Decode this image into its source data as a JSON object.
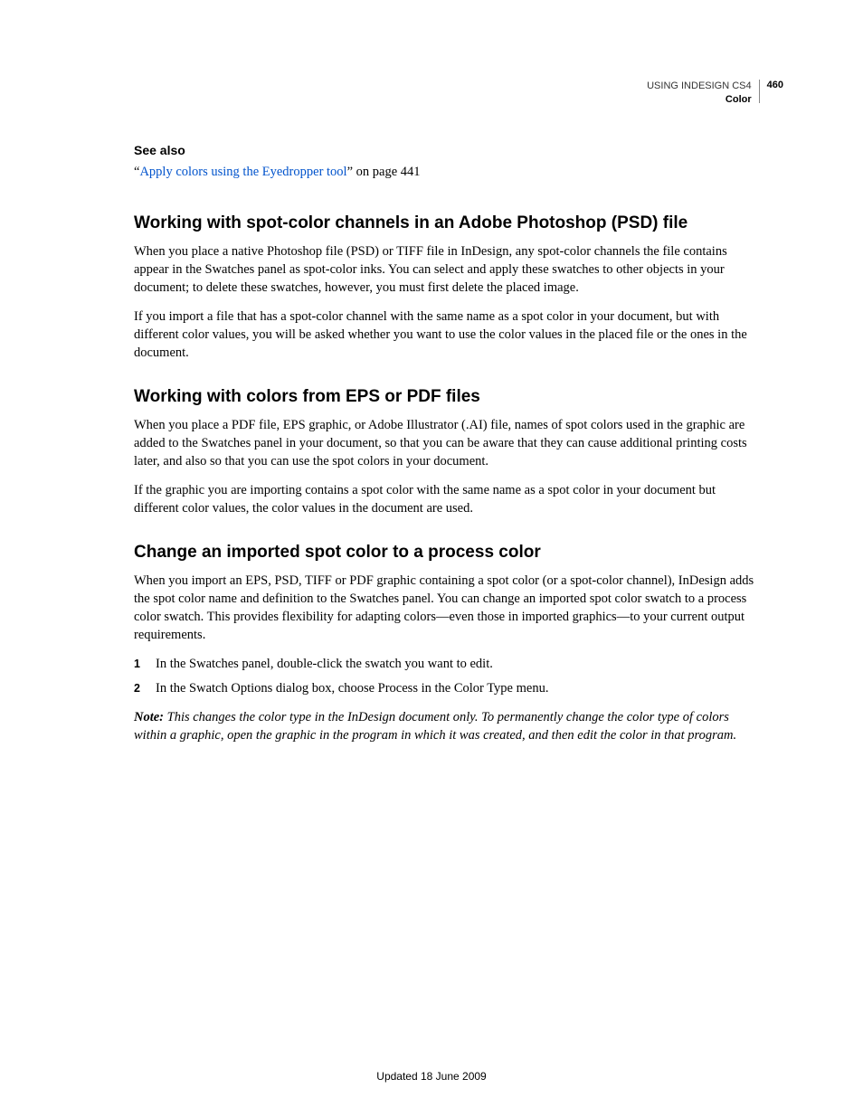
{
  "header": {
    "title": "USING INDESIGN CS4",
    "section": "Color",
    "page": "460"
  },
  "see_also": {
    "label": "See also",
    "quote_open": "“",
    "link": "Apply colors using the Eyedropper tool",
    "suffix": "” on page 441"
  },
  "sections": [
    {
      "heading": "Working with spot-color channels in an Adobe Photoshop (PSD) file",
      "paragraphs": [
        "When you place a native Photoshop file (PSD) or TIFF file in InDesign, any spot-color channels the file contains appear in the Swatches panel as spot-color inks. You can select and apply these swatches to other objects in your document; to delete these swatches, however, you must first delete the placed image.",
        "If you import a file that has a spot-color channel with the same name as a spot color in your document, but with different color values, you will be asked whether you want to use the color values in the placed file or the ones in the document."
      ]
    },
    {
      "heading": "Working with colors from EPS or PDF files",
      "paragraphs": [
        "When you place a PDF file, EPS graphic, or Adobe Illustrator (.AI) file, names of spot colors used in the graphic are added to the Swatches panel in your document, so that you can be aware that they can cause additional printing costs later, and also so that you can use the spot colors in your document.",
        "If the graphic you are importing contains a spot color with the same name as a spot color in your document but different color values, the color values in the document are used."
      ]
    },
    {
      "heading": "Change an imported spot color to a process color",
      "paragraphs": [
        "When you import an EPS, PSD, TIFF or PDF graphic containing a spot color (or a spot-color channel), InDesign adds the spot color name and definition to the Swatches panel. You can change an imported spot color swatch to a process color swatch. This provides flexibility for adapting colors—even those in imported graphics—to your current output requirements."
      ],
      "steps": [
        "In the Swatches panel, double-click the swatch you want to edit.",
        "In the Swatch Options dialog box, choose Process in the Color Type menu."
      ],
      "note": {
        "label": "Note:",
        "text": " This changes the color type in the InDesign document only. To permanently change the color type of colors within a graphic, open the graphic in the program in which it was created, and then edit the color in that program."
      }
    }
  ],
  "step_numbers": [
    "1",
    "2"
  ],
  "footer": "Updated 18 June 2009"
}
